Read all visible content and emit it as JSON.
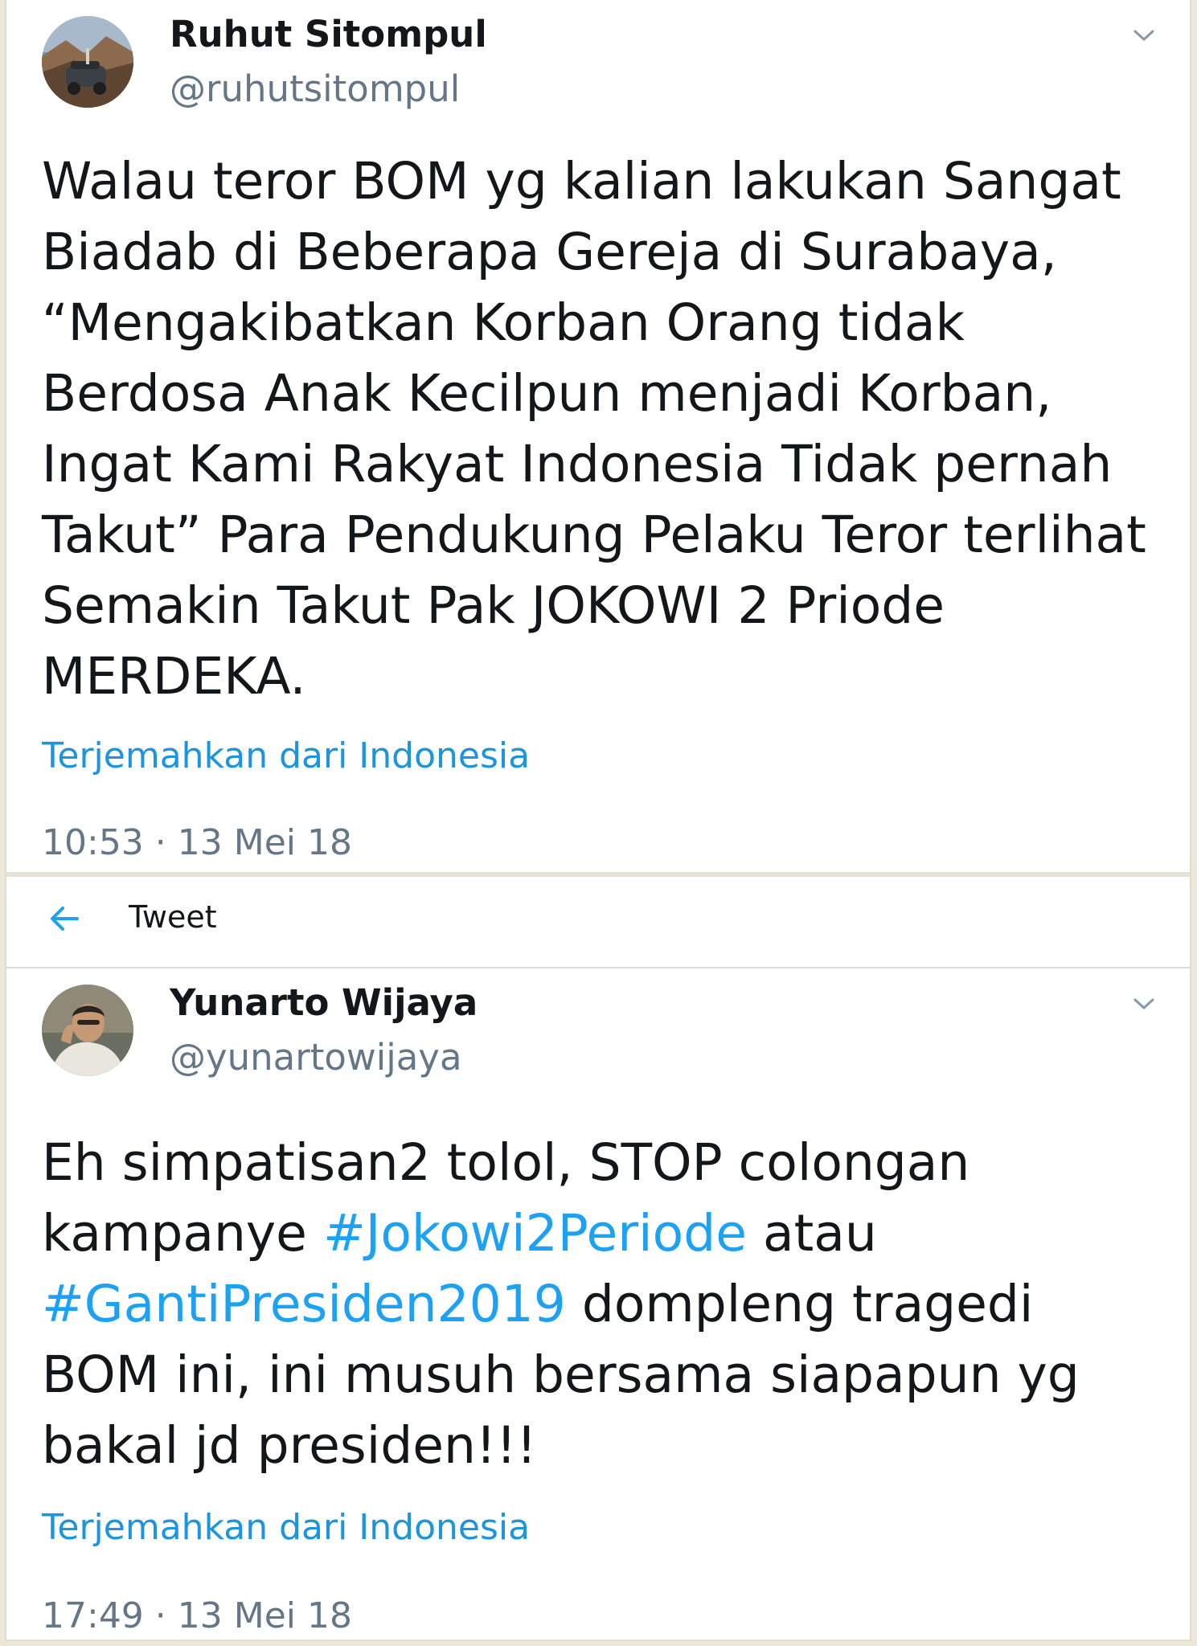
{
  "tweets": [
    {
      "author_name": "Ruhut Sitompul",
      "handle": "@ruhutsitompul",
      "text_lines": [
        "Walau teror BOM yg kalian lakukan Sangat",
        "Biadab di Beberapa Gereja di Surabaya,",
        "“Mengakibatkan Korban Orang tidak",
        "Berdosa Anak Kecilpun menjadi Korban,",
        "Ingat Kami Rakyat Indonesia Tidak pernah",
        "Takut” Para Pendukung Pelaku Teror terlihat",
        "Semakin Takut Pak JOKOWI 2 Priode",
        "MERDEKA."
      ],
      "translate_label": "Terjemahkan dari Indonesia",
      "timestamp": "10:53 · 13 Mei 18",
      "menu_icon": "chevron-down-icon"
    },
    {
      "author_name": "Yunarto Wijaya",
      "handle": "@yunartowijaya",
      "text_segments": {
        "line1": "Eh simpatisan2 tolol, STOP colongan",
        "line2_a": "kampanye ",
        "line2_hashtag": "#Jokowi2Periode",
        "line2_b": " atau",
        "line3_hashtag": "#GantiPresiden2019",
        "line3_b": " dompleng tragedi",
        "line4": "BOM ini, ini musuh bersama siapapun yg",
        "line5": "bakal jd presiden!!!"
      },
      "translate_label": "Terjemahkan dari Indonesia",
      "timestamp": "17:49 · 13 Mei 18",
      "menu_icon": "chevron-down-icon"
    }
  ],
  "header": {
    "title": "Tweet",
    "back_icon": "back-arrow-icon"
  },
  "colors": {
    "link": "#1b95e0",
    "hashtag": "#1da1f2",
    "text": "#14171a",
    "secondary": "#657786",
    "background_edge": "#ece7db"
  }
}
